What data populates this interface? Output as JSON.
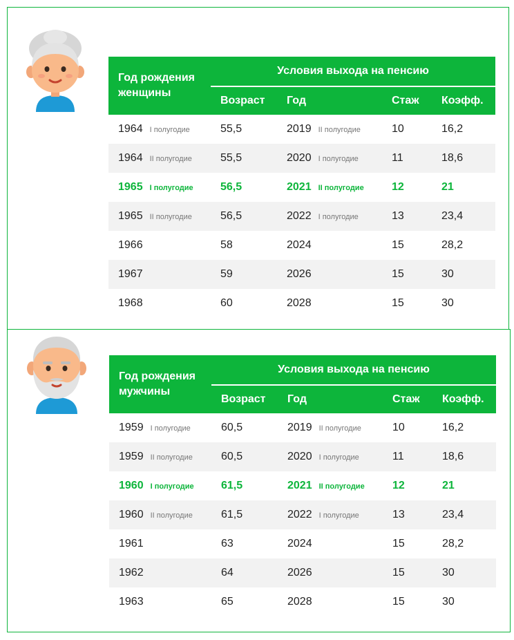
{
  "women": {
    "header": {
      "birth_label": "Год рождения женщины",
      "conditions_label": "Условия выхода на пенсию",
      "age": "Возраст",
      "year": "Год",
      "stazh": "Стаж",
      "koeff": "Коэфф."
    },
    "rows": [
      {
        "birth": "1964",
        "birth_half": "I полугодие",
        "age": "55,5",
        "year": "2019",
        "year_half": "II полугодие",
        "stazh": "10",
        "koeff": "16,2"
      },
      {
        "birth": "1964",
        "birth_half": "II полугодие",
        "age": "55,5",
        "year": "2020",
        "year_half": "I полугодие",
        "stazh": "11",
        "koeff": "18,6"
      },
      {
        "birth": "1965",
        "birth_half": "I полугодие",
        "age": "56,5",
        "year": "2021",
        "year_half": "II полугодие",
        "stazh": "12",
        "koeff": "21",
        "highlight": true
      },
      {
        "birth": "1965",
        "birth_half": "II полугодие",
        "age": "56,5",
        "year": "2022",
        "year_half": "I полугодие",
        "stazh": "13",
        "koeff": "23,4"
      },
      {
        "birth": "1966",
        "birth_half": "",
        "age": "58",
        "year": "2024",
        "year_half": "",
        "stazh": "15",
        "koeff": "28,2"
      },
      {
        "birth": "1967",
        "birth_half": "",
        "age": "59",
        "year": "2026",
        "year_half": "",
        "stazh": "15",
        "koeff": "30"
      },
      {
        "birth": "1968",
        "birth_half": "",
        "age": "60",
        "year": "2028",
        "year_half": "",
        "stazh": "15",
        "koeff": "30"
      }
    ]
  },
  "men": {
    "header": {
      "birth_label": "Год рождения мужчины",
      "conditions_label": "Условия выхода на пенсию",
      "age": "Возраст",
      "year": "Год",
      "stazh": "Стаж",
      "koeff": "Коэфф."
    },
    "rows": [
      {
        "birth": "1959",
        "birth_half": "I полугодие",
        "age": "60,5",
        "year": "2019",
        "year_half": "II полугодие",
        "stazh": "10",
        "koeff": "16,2"
      },
      {
        "birth": "1959",
        "birth_half": "II полугодие",
        "age": "60,5",
        "year": "2020",
        "year_half": "I полугодие",
        "stazh": "11",
        "koeff": "18,6"
      },
      {
        "birth": "1960",
        "birth_half": "I полугодие",
        "age": "61,5",
        "year": "2021",
        "year_half": "II полугодие",
        "stazh": "12",
        "koeff": "21",
        "highlight": true
      },
      {
        "birth": "1960",
        "birth_half": "II полугодие",
        "age": "61,5",
        "year": "2022",
        "year_half": "I полугодие",
        "stazh": "13",
        "koeff": "23,4"
      },
      {
        "birth": "1961",
        "birth_half": "",
        "age": "63",
        "year": "2024",
        "year_half": "",
        "stazh": "15",
        "koeff": "28,2"
      },
      {
        "birth": "1962",
        "birth_half": "",
        "age": "64",
        "year": "2026",
        "year_half": "",
        "stazh": "15",
        "koeff": "30"
      },
      {
        "birth": "1963",
        "birth_half": "",
        "age": "65",
        "year": "2028",
        "year_half": "",
        "stazh": "15",
        "koeff": "30"
      }
    ]
  },
  "colors": {
    "accent": "#0db53b",
    "stripe": "#f2f2f2",
    "muted": "#777777"
  },
  "icons": {
    "women_avatar": "grandmother-icon",
    "men_avatar": "grandfather-icon"
  }
}
